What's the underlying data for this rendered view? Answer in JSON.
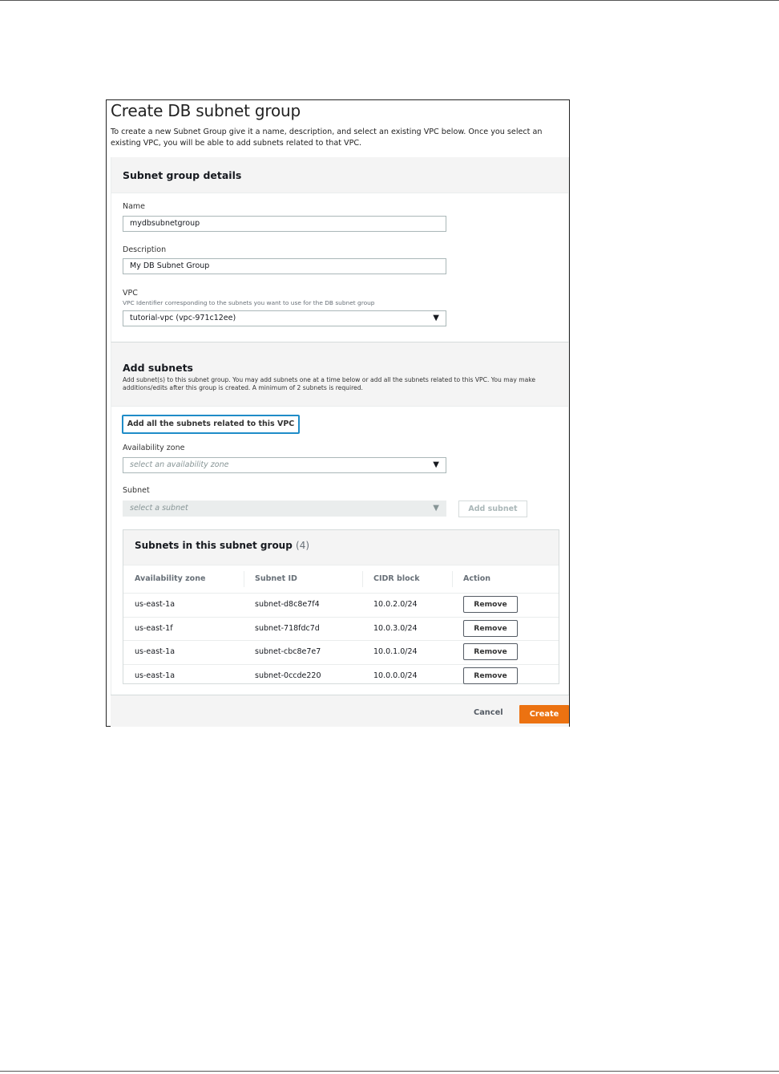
{
  "dialog": {
    "title": "Create DB subnet group",
    "intro": "To create a new Subnet Group give it a name, description, and select an existing VPC below. Once you select an existing VPC, you will be able to add subnets related to that VPC."
  },
  "details": {
    "heading": "Subnet group details",
    "name_label": "Name",
    "name_value": "mydbsubnetgroup",
    "description_label": "Description",
    "description_value": "My DB Subnet Group",
    "vpc_label": "VPC",
    "vpc_hint": "VPC Identifier corresponding to the subnets you want to use for the DB subnet group",
    "vpc_value": "tutorial-vpc (vpc-971c12ee)"
  },
  "add_subnets": {
    "heading": "Add subnets",
    "description": "Add subnet(s) to this subnet group. You may add subnets one at a time below or add all the subnets related to this VPC. You may make additions/edits after this group is created. A minimum of 2 subnets is required.",
    "add_all_label": "Add all the subnets related to this VPC",
    "az_label": "Availability zone",
    "az_placeholder": "select an availability zone",
    "subnet_label": "Subnet",
    "subnet_placeholder": "select a subnet",
    "add_subnet_label": "Add subnet"
  },
  "subnet_table": {
    "title": "Subnets in this subnet group",
    "count": "(4)",
    "columns": [
      "Availability zone",
      "Subnet ID",
      "CIDR block",
      "Action"
    ],
    "rows": [
      {
        "az": "us-east-1a",
        "subnet_id": "subnet-d8c8e7f4",
        "cidr": "10.0.2.0/24",
        "action": "Remove"
      },
      {
        "az": "us-east-1f",
        "subnet_id": "subnet-718fdc7d",
        "cidr": "10.0.3.0/24",
        "action": "Remove"
      },
      {
        "az": "us-east-1a",
        "subnet_id": "subnet-cbc8e7e7",
        "cidr": "10.0.1.0/24",
        "action": "Remove"
      },
      {
        "az": "us-east-1a",
        "subnet_id": "subnet-0ccde220",
        "cidr": "10.0.0.0/24",
        "action": "Remove"
      }
    ]
  },
  "footer": {
    "cancel_label": "Cancel",
    "create_label": "Create"
  },
  "icons": {
    "dropdown_caret": "▼"
  },
  "colors": {
    "primary": "#ec7211",
    "focus": "#1f8cc8"
  }
}
